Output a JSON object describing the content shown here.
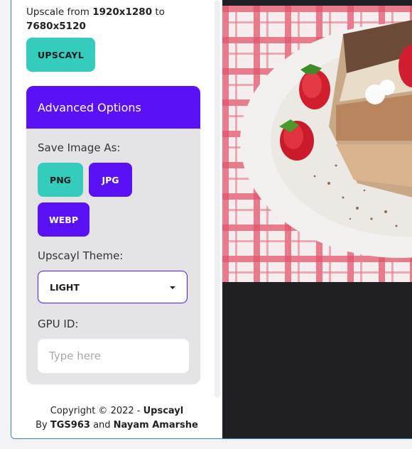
{
  "sidebar": {
    "upscale_prefix": "Upscale from ",
    "source_resolution": "1920x1280",
    "upscale_mid": " to",
    "target_resolution": "7680x5120",
    "upscayl_button": "UPSCAYL"
  },
  "advanced": {
    "title": "Advanced Options",
    "save_as_label": "Save Image As:",
    "formats": [
      "PNG",
      "JPG",
      "WEBP"
    ],
    "theme_label": "Upscayl Theme:",
    "theme_value": "LIGHT",
    "gpu_label": "GPU ID:",
    "gpu_placeholder": "Type here"
  },
  "footer": {
    "copyright": "Copyright © 2022 - ",
    "app_name": "Upscayl",
    "by": "By ",
    "author1": "TGS963",
    "and": " and ",
    "author2": "Nayam Amarshe"
  },
  "viewer": {
    "image_icon": "image-icon"
  },
  "colors": {
    "accent_teal": "#33ccbd",
    "accent_purple": "#5b11f6",
    "panel_bg": "#e4e4e6",
    "viewer_bg": "#1f1f24"
  }
}
